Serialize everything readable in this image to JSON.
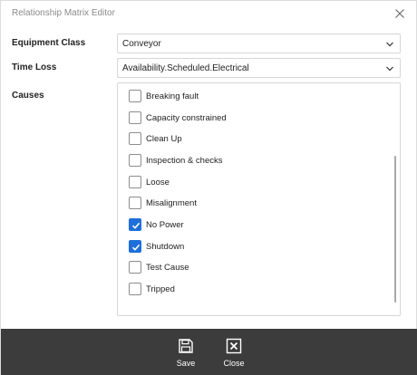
{
  "window": {
    "title": "Relationship Matrix Editor",
    "close_icon": "close-icon"
  },
  "fields": {
    "equipment_class": {
      "label": "Equipment Class",
      "value": "Conveyor"
    },
    "time_loss": {
      "label": "Time Loss",
      "value": "Availability.Scheduled.Electrical"
    },
    "causes": {
      "label": "Causes"
    }
  },
  "causes": [
    {
      "label": "Breaking fault",
      "checked": false
    },
    {
      "label": "Capacity constrained",
      "checked": false
    },
    {
      "label": "Clean Up",
      "checked": false
    },
    {
      "label": "Inspection & checks",
      "checked": false
    },
    {
      "label": "Loose",
      "checked": false
    },
    {
      "label": "Misalignment",
      "checked": false
    },
    {
      "label": "No Power",
      "checked": true
    },
    {
      "label": "Shutdown",
      "checked": true
    },
    {
      "label": "Test Cause",
      "checked": false
    },
    {
      "label": "Tripped",
      "checked": false
    }
  ],
  "footer": {
    "save_label": "Save",
    "close_label": "Close",
    "save_icon": "save-icon",
    "close_icon": "close-icon"
  },
  "colors": {
    "accent": "#1e6fd9",
    "footer_bg": "#3c3c3c"
  }
}
